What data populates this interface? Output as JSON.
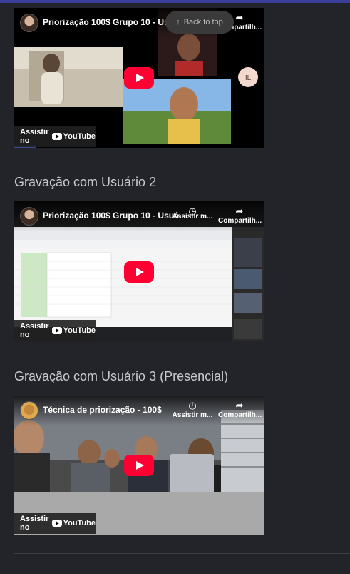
{
  "back_to_top": "Back to top",
  "videos": [
    {
      "title": "Priorização 100$ Grupo 10 - Usuá...",
      "share_label": "Compartilh...",
      "watch_label": "Assistir no",
      "logo_text": "YouTube",
      "participant_initials": "IL"
    },
    {
      "heading": "Gravação com Usuário 2",
      "title": "Priorização 100$ Grupo 10 - Usuá...",
      "watch_later_label": "Assistir m...",
      "share_label": "Compartilh...",
      "watch_label": "Assistir no",
      "logo_text": "YouTube"
    },
    {
      "heading": "Gravação com Usuário 3 (Presencial)",
      "title": "Técnica de priorização - 100$",
      "watch_later_label": "Assistir m...",
      "share_label": "Compartilh...",
      "watch_label": "Assistir no",
      "logo_text": "YouTube"
    }
  ],
  "colors": {
    "play": "#ff0033",
    "background": "#23232a",
    "top_bar": "#3a3d9a"
  }
}
